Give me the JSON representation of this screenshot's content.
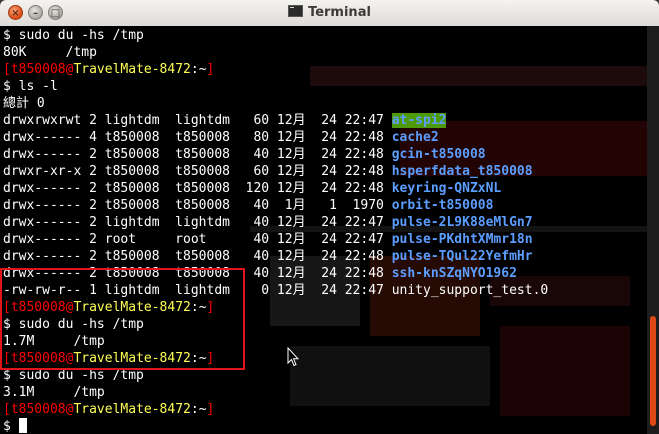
{
  "window": {
    "title": "Terminal",
    "buttons": {
      "close": "×",
      "minimize": "–",
      "maximize": "□"
    }
  },
  "prompt": {
    "user": "t850008",
    "host": "TravelMate-8472",
    "path": "~"
  },
  "lines": [
    {
      "type": "text",
      "text": "$ sudo du -hs /tmp"
    },
    {
      "type": "text",
      "text": "80K\t/tmp"
    },
    {
      "type": "prompt"
    },
    {
      "type": "text",
      "text": "$ ls -l"
    },
    {
      "type": "text",
      "text": "總計 0"
    },
    {
      "type": "ls",
      "meta": "drwxrwxrwt 2 lightdm  lightdm   60 12月  24 22:47 ",
      "name": "at-spi2",
      "style": "dir-hl"
    },
    {
      "type": "ls",
      "meta": "drwx------ 4 t850008  t850008   80 12月  24 22:48 ",
      "name": "cache2",
      "style": "dir"
    },
    {
      "type": "ls",
      "meta": "drwx------ 2 t850008  t850008   40 12月  24 22:48 ",
      "name": "gcin-t850008",
      "style": "dir"
    },
    {
      "type": "ls",
      "meta": "drwxr-xr-x 2 t850008  t850008   60 12月  24 22:48 ",
      "name": "hsperfdata_t850008",
      "style": "dir"
    },
    {
      "type": "ls",
      "meta": "drwx------ 2 t850008  t850008  120 12月  24 22:48 ",
      "name": "keyring-QNZxNL",
      "style": "dir"
    },
    {
      "type": "ls",
      "meta": "drwx------ 2 t850008  t850008   40  1月   1  1970 ",
      "name": "orbit-t850008",
      "style": "dir"
    },
    {
      "type": "ls",
      "meta": "drwx------ 2 lightdm  lightdm   40 12月  24 22:47 ",
      "name": "pulse-2L9K88eMlGn7",
      "style": "dir"
    },
    {
      "type": "ls",
      "meta": "drwx------ 2 root     root      40 12月  24 22:47 ",
      "name": "pulse-PKdhtXMmr18n",
      "style": "dir"
    },
    {
      "type": "ls",
      "meta": "drwx------ 2 t850008  t850008   40 12月  24 22:48 ",
      "name": "pulse-TQul22YefmHr",
      "style": "dir"
    },
    {
      "type": "ls",
      "meta": "drwx------ 2 t850008  t850008   40 12月  24 22:48 ",
      "name": "ssh-knSZqNYO1962",
      "style": "dir"
    },
    {
      "type": "ls",
      "meta": "-rw-rw-r-- 1 lightdm  lightdm    0 12月  24 22:47 ",
      "name": "unity_support_test.0",
      "style": "plain"
    },
    {
      "type": "prompt"
    },
    {
      "type": "text",
      "text": "$ sudo du -hs /tmp"
    },
    {
      "type": "text",
      "text": "1.7M\t/tmp"
    },
    {
      "type": "prompt"
    },
    {
      "type": "text",
      "text": "$ sudo du -hs /tmp"
    },
    {
      "type": "text",
      "text": "3.1M\t/tmp"
    },
    {
      "type": "prompt"
    },
    {
      "type": "input",
      "text": "$ "
    }
  ],
  "colors": {
    "accent": "#dd4814",
    "prompt_user": "#ff0000",
    "prompt_host": "#ffff55",
    "directory": "#5c9eff",
    "highlight_bg": "#4e9a06",
    "annotation_box": "#e0151b"
  }
}
